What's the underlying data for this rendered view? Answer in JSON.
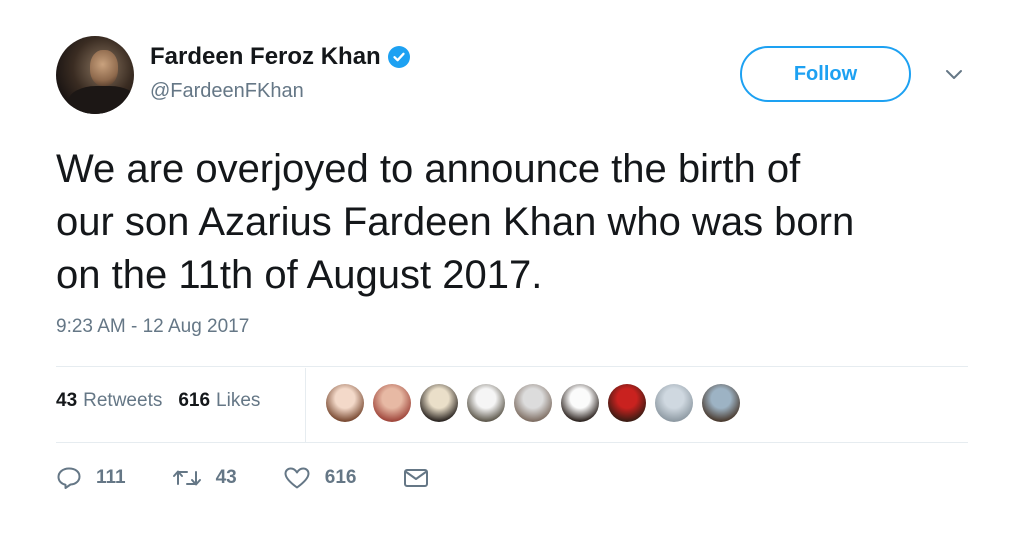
{
  "user": {
    "display_name": "Fardeen Feroz Khan",
    "handle": "@FardeenFKhan",
    "verified": true,
    "avatar_icon": "profile-photo"
  },
  "follow_button": {
    "label": "Follow"
  },
  "menu_icon": "chevron-down-icon",
  "tweet": {
    "text_lines": [
      "We are overjoyed to announce the birth of",
      "our son Azarius Fardeen Khan who was born",
      "on the 11th of August 2017."
    ],
    "timestamp": "9:23 AM - 12 Aug 2017"
  },
  "stats": {
    "retweets_count": "43",
    "retweets_label": "Retweets",
    "likes_count": "616",
    "likes_label": "Likes"
  },
  "likers": [
    {
      "name": "liker-avatar-1",
      "colors": [
        "#f3d9c9",
        "#7a4b33"
      ]
    },
    {
      "name": "liker-avatar-2",
      "colors": [
        "#e7b9a4",
        "#a0473c"
      ]
    },
    {
      "name": "liker-avatar-3",
      "colors": [
        "#eadfc9",
        "#2c2622"
      ]
    },
    {
      "name": "liker-avatar-4",
      "colors": [
        "#f5f5f5",
        "#5f5a4e"
      ]
    },
    {
      "name": "liker-avatar-5",
      "colors": [
        "#dcdcdc",
        "#7f6f64"
      ]
    },
    {
      "name": "liker-avatar-6",
      "colors": [
        "#fbfbfb",
        "#2f2622"
      ]
    },
    {
      "name": "liker-avatar-7",
      "colors": [
        "#c9221f",
        "#3b1c14"
      ]
    },
    {
      "name": "liker-avatar-8",
      "colors": [
        "#cfd8e0",
        "#8e9aa3"
      ]
    },
    {
      "name": "liker-avatar-9",
      "colors": [
        "#9db3c4",
        "#4a3b30"
      ]
    }
  ],
  "actions": {
    "reply_count": "111",
    "retweet_count": "43",
    "like_count": "616"
  },
  "colors": {
    "accent": "#1da1f2",
    "text": "#14171a",
    "muted": "#657786",
    "divider": "#e6ecf0"
  }
}
